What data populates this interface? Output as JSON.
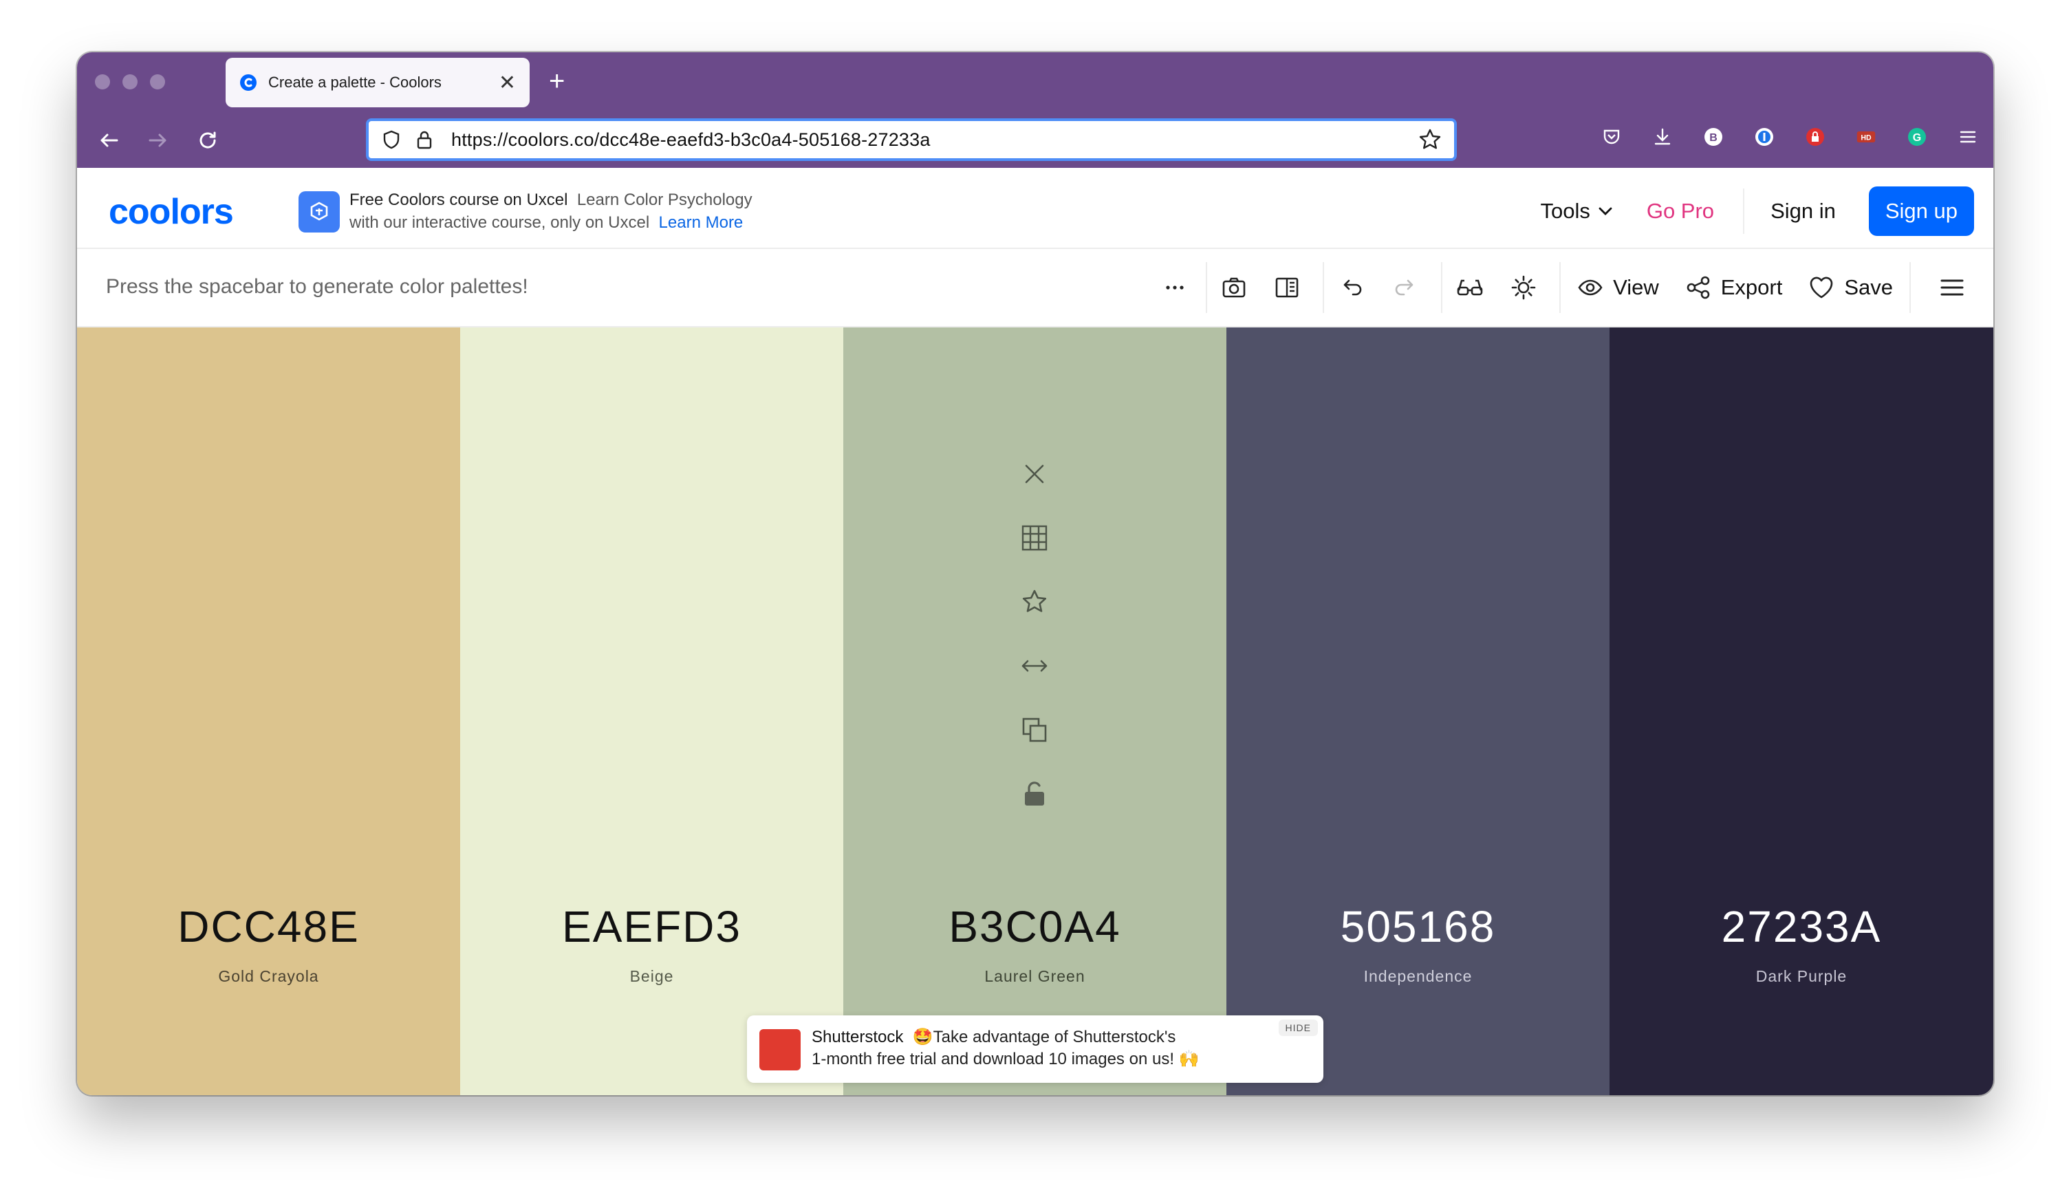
{
  "browser": {
    "tab_title": "Create a palette - Coolors",
    "url": "https://coolors.co/dcc48e-eaefd3-b3c0a4-505168-27233a",
    "new_tab_label": "+",
    "close_tab_label": "✕"
  },
  "header": {
    "logo": "coolors",
    "promo_title": "Free Coolors course on Uxcel",
    "promo_subtitle": "Learn Color Psychology",
    "promo_line2": "with our interactive course, only on Uxcel",
    "promo_link": "Learn More",
    "tools_label": "Tools",
    "gopro_label": "Go Pro",
    "signin_label": "Sign in",
    "signup_label": "Sign up"
  },
  "toolbar": {
    "hint": "Press the spacebar to generate color palettes!",
    "view_label": "View",
    "export_label": "Export",
    "save_label": "Save"
  },
  "palette": [
    {
      "hex": "DCC48E",
      "name": "Gold Crayola",
      "color": "#DCC48E",
      "text": "#111111",
      "sub": "#4a4230"
    },
    {
      "hex": "EAEFD3",
      "name": "Beige",
      "color": "#EAEFD3",
      "text": "#111111",
      "sub": "#555a4a"
    },
    {
      "hex": "B3C0A4",
      "name": "Laurel Green",
      "color": "#B3C0A4",
      "text": "#111111",
      "sub": "#3e4535"
    },
    {
      "hex": "505168",
      "name": "Independence",
      "color": "#505168",
      "text": "#ffffff",
      "sub": "#d0d0dc"
    },
    {
      "hex": "27233A",
      "name": "Dark Purple",
      "color": "#27233A",
      "text": "#ffffff",
      "sub": "#c8c6d4"
    }
  ],
  "ad": {
    "brand": "Shutterstock",
    "line1": "🤩Take advantage of Shutterstock's",
    "line2": "1-month free trial and download 10 images on us! 🙌",
    "hide_label": "HIDE"
  }
}
